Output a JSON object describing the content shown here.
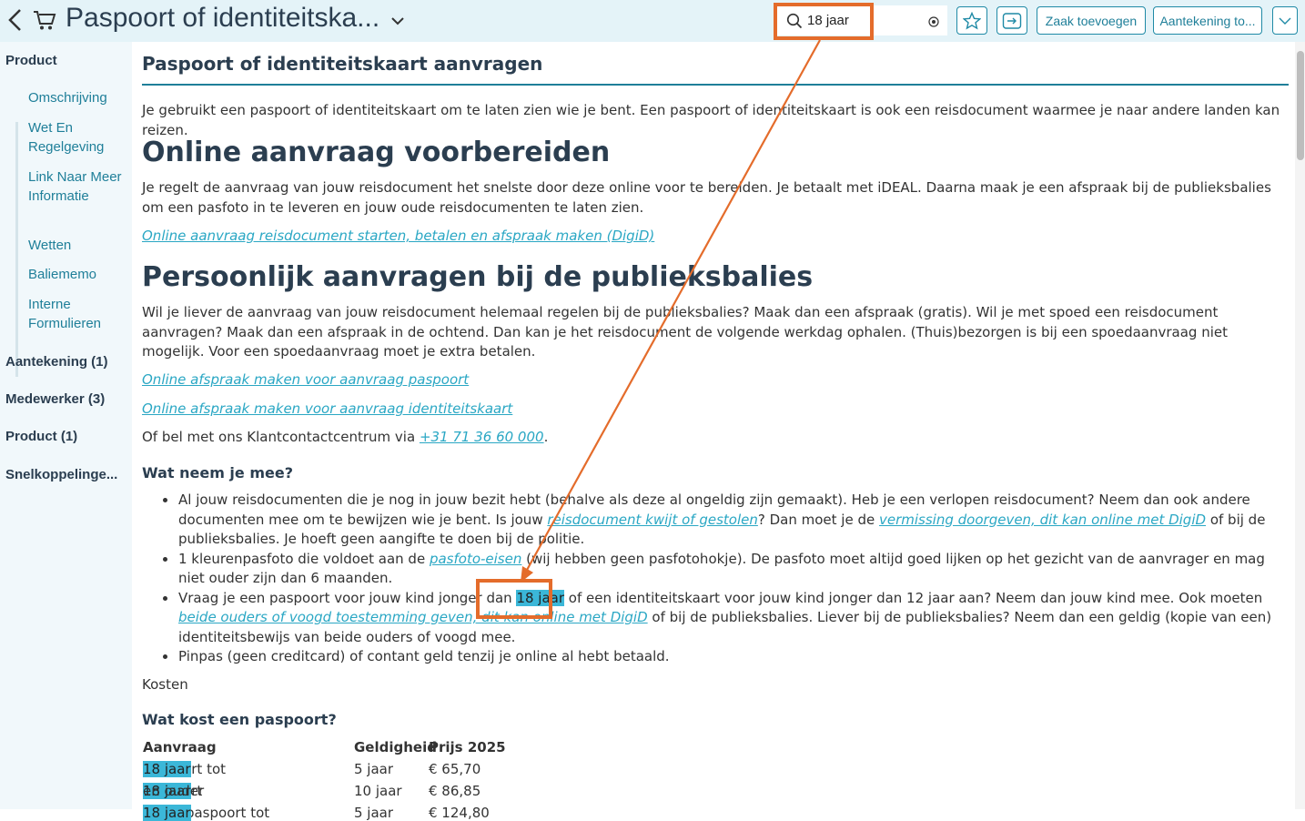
{
  "header": {
    "title": "Paspoort of identiteitska...",
    "search_value": "18 jaar",
    "btn_zaak": "Zaak toevoegen",
    "btn_aantekening": "Aantekening to..."
  },
  "sidebar": {
    "product": "Product",
    "items": [
      "Omschrijving",
      "Wet En Regelgeving",
      "Link Naar Meer Informatie",
      "Wetten",
      "Baliememo",
      "Interne Formulieren"
    ],
    "aantekening": "Aantekening (1)",
    "medewerker": "Medewerker (3)",
    "product_count": "Product (1)",
    "snelkoppelingen": "Snelkoppelinge..."
  },
  "content": {
    "title": "Paspoort of identiteitskaart aanvragen",
    "intro": "Je gebruikt een paspoort of identiteitskaart om te laten zien wie je bent. Een paspoort of identiteitskaart is ook een reisdocument waarmee je naar andere landen kan reizen.",
    "h_online": "Online aanvraag voorbereiden",
    "p_online": "Je regelt de aanvraag van jouw reisdocument het snelste door deze online voor te bereiden. Je betaalt met iDEAL. Daarna maak je een afspraak bij de publieksbalies om een pasfoto in te leveren en jouw oude reisdocumenten te laten zien.",
    "link_online": "Online aanvraag reisdocument starten, betalen en afspraak maken (DigiD)",
    "h_persoonlijk": "Persoonlijk aanvragen bij de publieksbalies",
    "p_persoonlijk": "Wil je liever de aanvraag van jouw reisdocument helemaal regelen bij de publieksbalies? Maak dan een afspraak (gratis). Wil je met spoed een reisdocument aanvragen? Maak dan een afspraak in de ochtend. Dan kan je het reisdocument de volgende werkdag ophalen. (Thuis)bezorgen is bij een spoedaanvraag niet mogelijk. Voor een spoedaanvraag moet je extra betalen.",
    "link_paspoort": "Online afspraak maken voor aanvraag paspoort",
    "link_id": "Online afspraak maken voor aanvraag identiteitskaart",
    "bel_pre": "Of bel met ons Klantcontactcentrum via ",
    "bel_phone": "+31 71 36 60 000",
    "bel_post": ".",
    "h_mee": "Wat neem je mee?",
    "b1_a": "Al jouw reisdocumenten die je nog in jouw bezit hebt (behalve als deze al ongeldig zijn gemaakt). Heb je een verlopen reisdocument? Neem dan ook andere documenten mee om te bewijzen wie je bent. Is jouw ",
    "b1_link1": "reisdocument kwijt of gestolen",
    "b1_b": "? Dan moet je de ",
    "b1_link2": "vermissing doorgeven, dit kan online met DigiD",
    "b1_c": " of bij de publieksbalies. Je hoeft geen aangifte te doen bij de politie.",
    "b2_a": "1 kleurenpasfoto die voldoet aan de ",
    "b2_link": "pasfoto-eisen",
    "b2_b": " (wij hebben geen pasfotohokje). De pasfoto moet altijd goed lijken op het gezicht van de aanvrager en mag niet ouder zijn dan 6 maanden.",
    "b3_a": "Vraag je een paspoort voor jouw kind jonger dan ",
    "b3_hl": "18 jaar",
    "b3_b": " of een identiteitskaart voor jouw kind jonger dan 12 jaar aan? Neem dan jouw kind mee. Ook moeten ",
    "b3_link": "beide ouders of voogd toestemming geven, dit kan online met DigiD",
    "b3_c": " of bij de publieksbalies. Liever bij de publieksbalies? Neem dan een geldig (kopie van een) identiteitsbewijs van beide ouders of voogd mee.",
    "b4": "Pinpas (geen creditcard) of contant geld tenzij je online al hebt betaald.",
    "kosten": "Kosten",
    "h_kost": "Wat kost een paspoort?",
    "table": {
      "headers": [
        "Aanvraag",
        "Geldigheid",
        "Prijs 2025"
      ],
      "rows": [
        {
          "pre": "Paspoort tot ",
          "hl": "18 jaar",
          "post": "",
          "geldig": "5 jaar",
          "prijs": "€ 65,70"
        },
        {
          "pre": "Paspoort ",
          "hl": "18 jaar",
          "post": " en ouder",
          "geldig": "10 jaar",
          "prijs": "€ 86,85"
        },
        {
          "pre": "Spoedpaspoort tot ",
          "hl": "18 jaar",
          "post": "",
          "geldig": "5 jaar",
          "prijs": "€ 124,80"
        }
      ]
    }
  },
  "colors": {
    "accent": "#1f8aa6",
    "highlight": "#3bb7d8",
    "annotation": "#e46c2b"
  }
}
